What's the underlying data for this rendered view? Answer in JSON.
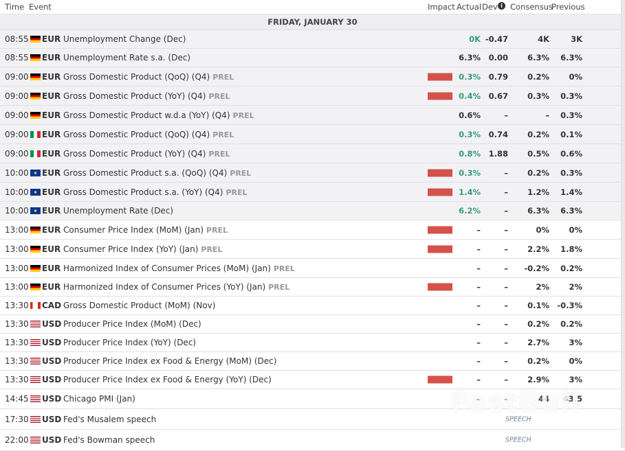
{
  "header": {
    "time": "Time",
    "event": "Event",
    "impact": "Impact",
    "actual": "Actual",
    "dev": "Dev",
    "consensus": "Consensus",
    "previous": "Previous",
    "info_icon": "info-icon"
  },
  "date": "FRIDAY, JANUARY 30",
  "colors": {
    "medium": "#e6891f",
    "high": "#d4524a",
    "positive": "#3a9a7a"
  },
  "watermark": "FastBull",
  "rows": [
    {
      "time": "08:55",
      "flag": "de",
      "cur": "EUR",
      "event": "Unemployment Change (Dec)",
      "prel": "",
      "impact": "medium",
      "actual": "0K",
      "actual_green": true,
      "dev": "-0.47",
      "consensus": "4K",
      "previous": "3K",
      "past": true
    },
    {
      "time": "08:55",
      "flag": "de",
      "cur": "EUR",
      "event": "Unemployment Rate s.a. (Dec)",
      "prel": "",
      "impact": "medium",
      "actual": "6.3%",
      "actual_green": false,
      "dev": "0.00",
      "consensus": "6.3%",
      "previous": "6.3%",
      "past": true
    },
    {
      "time": "09:00",
      "flag": "de",
      "cur": "EUR",
      "event": "Gross Domestic Product (QoQ) (Q4)",
      "prel": "PREL",
      "impact": "high",
      "actual": "0.3%",
      "actual_green": true,
      "dev": "0.79",
      "consensus": "0.2%",
      "previous": "0%",
      "past": true
    },
    {
      "time": "09:00",
      "flag": "de",
      "cur": "EUR",
      "event": "Gross Domestic Product (YoY) (Q4)",
      "prel": "PREL",
      "impact": "high",
      "actual": "0.4%",
      "actual_green": true,
      "dev": "0.67",
      "consensus": "0.3%",
      "previous": "0.3%",
      "past": true
    },
    {
      "time": "09:00",
      "flag": "de",
      "cur": "EUR",
      "event": "Gross Domestic Product w.d.a (YoY) (Q4)",
      "prel": "PREL",
      "impact": "medium",
      "actual": "0.6%",
      "actual_green": false,
      "dev": "–",
      "consensus": "–",
      "previous": "0.3%",
      "past": true
    },
    {
      "time": "09:00",
      "flag": "it",
      "cur": "EUR",
      "event": "Gross Domestic Product (QoQ) (Q4)",
      "prel": "PREL",
      "impact": "medium",
      "actual": "0.3%",
      "actual_green": true,
      "dev": "0.74",
      "consensus": "0.2%",
      "previous": "0.1%",
      "past": true
    },
    {
      "time": "09:00",
      "flag": "it",
      "cur": "EUR",
      "event": "Gross Domestic Product (YoY) (Q4)",
      "prel": "PREL",
      "impact": "medium",
      "actual": "0.8%",
      "actual_green": true,
      "dev": "1.88",
      "consensus": "0.5%",
      "previous": "0.6%",
      "past": true
    },
    {
      "time": "10:00",
      "flag": "eu",
      "cur": "EUR",
      "event": "Gross Domestic Product s.a. (QoQ) (Q4)",
      "prel": "PREL",
      "impact": "high",
      "actual": "0.3%",
      "actual_green": true,
      "dev": "–",
      "consensus": "0.2%",
      "previous": "0.3%",
      "past": true
    },
    {
      "time": "10:00",
      "flag": "eu",
      "cur": "EUR",
      "event": "Gross Domestic Product s.a. (YoY) (Q4)",
      "prel": "PREL",
      "impact": "high",
      "actual": "1.4%",
      "actual_green": true,
      "dev": "–",
      "consensus": "1.2%",
      "previous": "1.4%",
      "past": true
    },
    {
      "time": "10:00",
      "flag": "eu",
      "cur": "EUR",
      "event": "Unemployment Rate (Dec)",
      "prel": "",
      "impact": "medium",
      "actual": "6.2%",
      "actual_green": true,
      "dev": "–",
      "consensus": "6.3%",
      "previous": "6.3%",
      "past": true
    },
    {
      "time": "13:00",
      "flag": "de",
      "cur": "EUR",
      "event": "Consumer Price Index (MoM) (Jan)",
      "prel": "PREL",
      "impact": "high",
      "actual": "–",
      "actual_green": false,
      "dev": "–",
      "consensus": "0%",
      "previous": "0%",
      "past": false
    },
    {
      "time": "13:00",
      "flag": "de",
      "cur": "EUR",
      "event": "Consumer Price Index (YoY) (Jan)",
      "prel": "PREL",
      "impact": "high",
      "actual": "–",
      "actual_green": false,
      "dev": "–",
      "consensus": "2.2%",
      "previous": "1.8%",
      "past": false
    },
    {
      "time": "13:00",
      "flag": "de",
      "cur": "EUR",
      "event": "Harmonized Index of Consumer Prices (MoM) (Jan)",
      "prel": "PREL",
      "impact": "medium",
      "actual": "–",
      "actual_green": false,
      "dev": "–",
      "consensus": "-0.2%",
      "previous": "0.2%",
      "past": false
    },
    {
      "time": "13:00",
      "flag": "de",
      "cur": "EUR",
      "event": "Harmonized Index of Consumer Prices (YoY) (Jan)",
      "prel": "PREL",
      "impact": "high",
      "actual": "–",
      "actual_green": false,
      "dev": "–",
      "consensus": "2%",
      "previous": "2%",
      "past": false
    },
    {
      "time": "13:30",
      "flag": "ca",
      "cur": "CAD",
      "event": "Gross Domestic Product (MoM) (Nov)",
      "prel": "",
      "impact": "medium",
      "actual": "–",
      "actual_green": false,
      "dev": "–",
      "consensus": "0.1%",
      "previous": "-0.3%",
      "past": false
    },
    {
      "time": "13:30",
      "flag": "us",
      "cur": "USD",
      "event": "Producer Price Index (MoM) (Dec)",
      "prel": "",
      "impact": "medium",
      "actual": "–",
      "actual_green": false,
      "dev": "–",
      "consensus": "0.2%",
      "previous": "0.2%",
      "past": false
    },
    {
      "time": "13:30",
      "flag": "us",
      "cur": "USD",
      "event": "Producer Price Index (YoY) (Dec)",
      "prel": "",
      "impact": "medium",
      "actual": "–",
      "actual_green": false,
      "dev": "–",
      "consensus": "2.7%",
      "previous": "3%",
      "past": false
    },
    {
      "time": "13:30",
      "flag": "us",
      "cur": "USD",
      "event": "Producer Price Index ex Food & Energy (MoM) (Dec)",
      "prel": "",
      "impact": "medium",
      "actual": "–",
      "actual_green": false,
      "dev": "–",
      "consensus": "0.2%",
      "previous": "0%",
      "past": false
    },
    {
      "time": "13:30",
      "flag": "us",
      "cur": "USD",
      "event": "Producer Price Index ex Food & Energy (YoY) (Dec)",
      "prel": "",
      "impact": "high",
      "actual": "–",
      "actual_green": false,
      "dev": "–",
      "consensus": "2.9%",
      "previous": "3%",
      "past": false
    },
    {
      "time": "14:45",
      "flag": "us",
      "cur": "USD",
      "event": "Chicago PMI (Jan)",
      "prel": "",
      "impact": "medium",
      "actual": "–",
      "actual_green": false,
      "dev": "–",
      "consensus": "44",
      "previous": "43.5",
      "past": false
    },
    {
      "time": "17:30",
      "flag": "us",
      "cur": "USD",
      "event": "Fed's Musalem speech",
      "prel": "",
      "impact": "medium",
      "speech": "SPEECH",
      "past": false
    },
    {
      "time": "22:00",
      "flag": "us",
      "cur": "USD",
      "event": "Fed's Bowman speech",
      "prel": "",
      "impact": "medium",
      "speech": "SPEECH",
      "past": false
    }
  ]
}
